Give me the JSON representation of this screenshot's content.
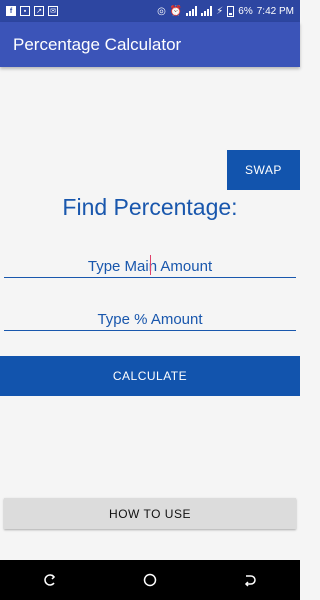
{
  "status_bar": {
    "battery": "6%",
    "time": "7:42 PM",
    "icons": [
      "facebook-icon",
      "gallery-icon",
      "missed-call-icon",
      "email-icon",
      "hotspot-icon",
      "alarm-icon",
      "signal-icon",
      "signal-icon",
      "charging-icon",
      "battery-icon"
    ]
  },
  "app_bar": {
    "title": "Percentage Calculator"
  },
  "swap_label": "SWAP",
  "heading": "Find Percentage:",
  "main_amount": {
    "placeholder": "Type Main Amount",
    "value": ""
  },
  "percent_amount": {
    "placeholder": "Type % Amount",
    "value": ""
  },
  "calculate_label": "CALCULATE",
  "how_to_use_label": "HOW TO USE",
  "nav": {
    "icons": [
      "recents-icon",
      "home-icon",
      "back-icon"
    ]
  },
  "colors": {
    "primary": "#3b54b8",
    "status_bar": "#2d46a1",
    "button": "#1254ad",
    "text_accent": "#1957ad",
    "secondary_button": "#dcdcdc"
  }
}
